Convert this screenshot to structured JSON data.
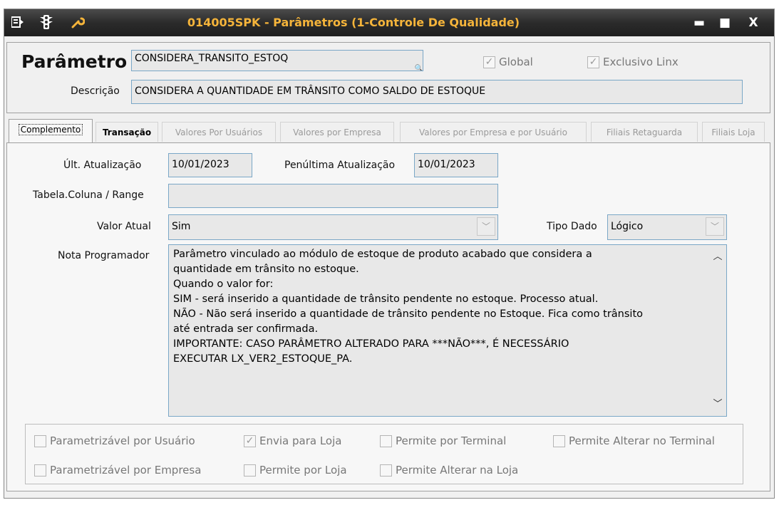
{
  "window": {
    "title": "014005SPK - Parâmetros (1-Controle De Qualidade)",
    "icons": [
      "menu-icon",
      "traffic-light-icon",
      "wrench-icon"
    ],
    "controls": {
      "minimize": "▬",
      "maximize": "■",
      "close": "X"
    }
  },
  "header": {
    "param_label": "Parâmetro",
    "param_value": "CONSIDERA_TRANSITO_ESTOQ",
    "desc_label": "Descrição",
    "desc_value": "CONSIDERA A QUANTIDADE EM TRÂNSITO COMO SALDO DE ESTOQUE",
    "global_label": "Global",
    "global_checked": true,
    "exclusivo_label": "Exclusivo Linx",
    "exclusivo_checked": true
  },
  "tabs": [
    {
      "label": "Complemento",
      "state": "active"
    },
    {
      "label": "Transação",
      "state": "enabled"
    },
    {
      "label": "Valores Por Usuários",
      "state": "disabled"
    },
    {
      "label": "Valores por Empresa",
      "state": "disabled"
    },
    {
      "label": "Valores por Empresa e por Usuário",
      "state": "disabled"
    },
    {
      "label": "Filiais Retaguarda",
      "state": "disabled"
    },
    {
      "label": "Filiais Loja",
      "state": "disabled"
    }
  ],
  "complemento": {
    "ult_atualizacao_label": "Últ. Atualização",
    "ult_atualizacao_value": "10/01/2023",
    "penultima_label": "Penúltima Atualização",
    "penultima_value": "10/01/2023",
    "tabela_label": "Tabela.Coluna / Range",
    "tabela_value": "",
    "valor_atual_label": "Valor Atual",
    "valor_atual_value": "Sim",
    "tipo_dado_label": "Tipo Dado",
    "tipo_dado_value": "Lógico",
    "nota_label": "Nota Programador",
    "nota_value": "Parâmetro vinculado ao módulo de estoque de produto acabado que considera a\nquantidade em trânsito no estoque.\nQuando o valor for:\nSIM - será inserido a quantidade de trânsito pendente no estoque. Processo atual.\nNÃO - Não será inserido a quantidade de trânsito pendente no Estoque. Fica como trânsito\naté entrada ser confirmada.\nIMPORTANTE: CASO PARÂMETRO ALTERADO PARA ***NÃO***, É NECESSÁRIO\nEXECUTAR LX_VER2_ESTOQUE_PA."
  },
  "options": [
    {
      "label": "Parametrizável por Usuário",
      "checked": false
    },
    {
      "label": "Envia para Loja",
      "checked": true
    },
    {
      "label": "Permite por Terminal",
      "checked": false
    },
    {
      "label": "Permite Alterar no Terminal",
      "checked": false
    },
    {
      "label": "Parametrizável por Empresa",
      "checked": false
    },
    {
      "label": "Permite por Loja",
      "checked": false
    },
    {
      "label": "Permite Alterar na Loja",
      "checked": false
    }
  ],
  "colors": {
    "title_text": "#f5b43a",
    "title_bar": "#2b2b2b",
    "field_border": "#7aa7c7",
    "field_bg": "#e8e8e8"
  }
}
